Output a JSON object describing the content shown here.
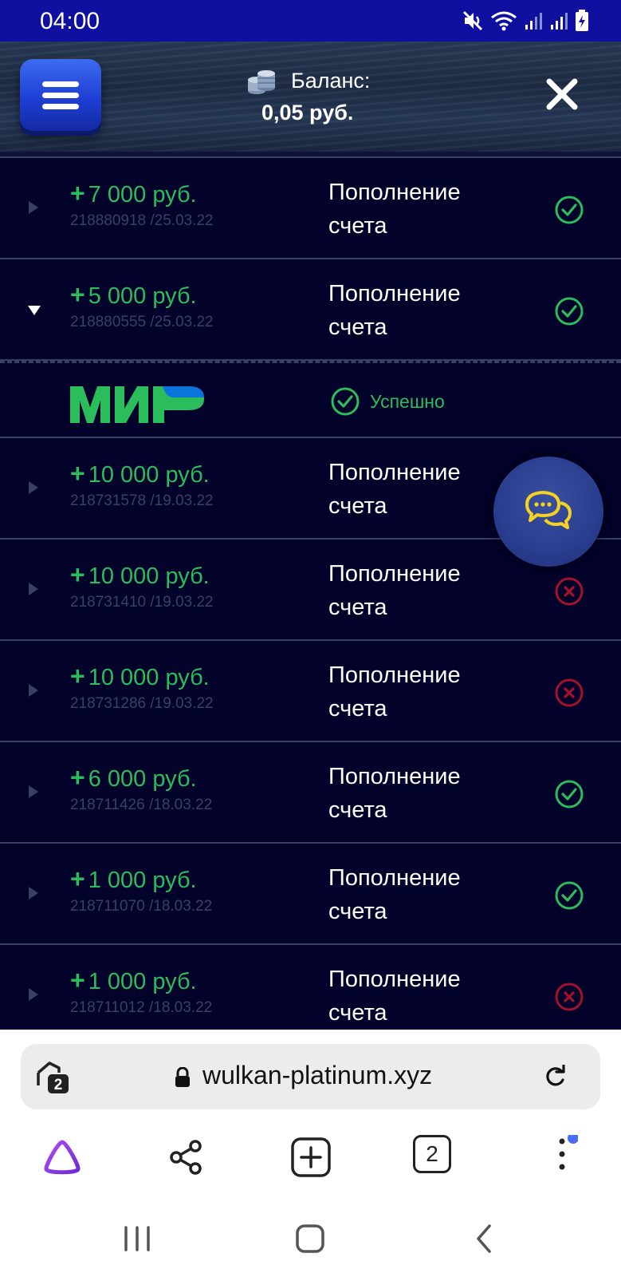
{
  "status_bar": {
    "time": "04:00"
  },
  "header": {
    "balance_label": "Баланс:",
    "balance_value": "0,05 руб."
  },
  "transactions": [
    {
      "amount": "7 000 руб.",
      "id": "218880918 /25.03.22",
      "type": "Пополнение счета",
      "status": "success",
      "expanded": false
    },
    {
      "amount": "5 000 руб.",
      "id": "218880555 /25.03.22",
      "type": "Пополнение счета",
      "status": "success",
      "expanded": true
    },
    {
      "amount": "10 000 руб.",
      "id": "218731578 /19.03.22",
      "type": "Пополнение счета",
      "status": "hidden",
      "expanded": false
    },
    {
      "amount": "10 000 руб.",
      "id": "218731410 /19.03.22",
      "type": "Пополнение счета",
      "status": "failed",
      "expanded": false
    },
    {
      "amount": "10 000 руб.",
      "id": "218731286 /19.03.22",
      "type": "Пополнение счета",
      "status": "failed",
      "expanded": false
    },
    {
      "amount": "6 000 руб.",
      "id": "218711426 /18.03.22",
      "type": "Пополнение счета",
      "status": "success",
      "expanded": false
    },
    {
      "amount": "1 000 руб.",
      "id": "218711070 /18.03.22",
      "type": "Пополнение счета",
      "status": "success",
      "expanded": false
    },
    {
      "amount": "1 000 руб.",
      "id": "218711012 /18.03.22",
      "type": "Пополнение счета",
      "status": "failed",
      "expanded": false
    }
  ],
  "detail": {
    "payment_system": "МИР",
    "status_text": "Успешно"
  },
  "browser": {
    "tabs_count": "2",
    "url": "wulkan-platinum.xyz"
  },
  "colors": {
    "status_bar": "#0f0fa0",
    "list_background": "#02022a",
    "success": "#2bbd5b",
    "failed": "#a3122a",
    "divider": "#3a3f66",
    "mir_green": "#2bbd5b",
    "mir_blue": "#0b74d8",
    "alice_purple": "#8a2be2"
  },
  "icons": [
    "menu-icon",
    "coins-icon",
    "close-icon",
    "chat-icon",
    "lock-icon",
    "reload-icon",
    "alice-icon",
    "share-icon",
    "new-tab-icon",
    "more-icon"
  ]
}
